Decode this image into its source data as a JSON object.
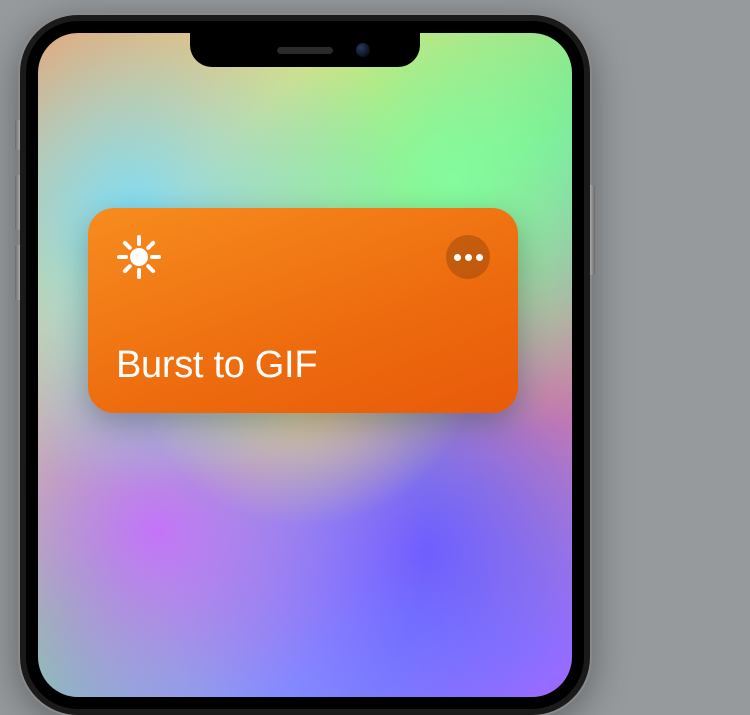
{
  "shortcut": {
    "title": "Burst to GIF",
    "icon_name": "sun-icon",
    "card_color": "#ed6b0e"
  }
}
